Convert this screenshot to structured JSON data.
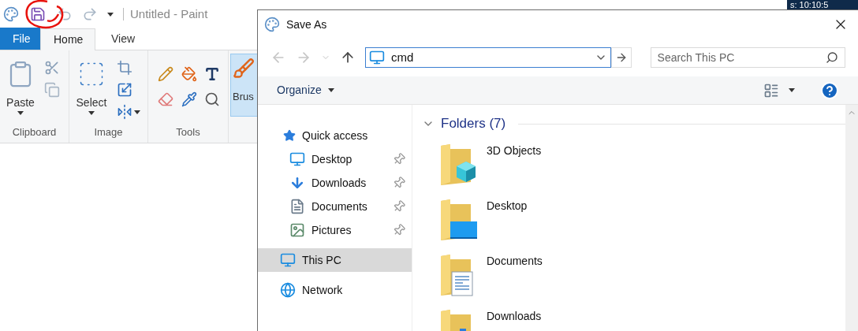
{
  "paint": {
    "title": "Untitled - Paint",
    "tabs": [
      {
        "label": "File",
        "kind": "file",
        "selected": false
      },
      {
        "label": "Home",
        "kind": "tab",
        "selected": true
      },
      {
        "label": "View",
        "kind": "tab",
        "selected": false
      }
    ],
    "groups": [
      {
        "label": "Clipboard",
        "button": "Paste"
      },
      {
        "label": "Image",
        "button": "Select"
      },
      {
        "label": "Tools"
      }
    ],
    "brush_button": {
      "label": "Brus",
      "selected": true
    }
  },
  "clock_strip": "s: 10:10:5",
  "dialog": {
    "title": "Save As",
    "address": {
      "value": "cmd"
    },
    "search": {
      "placeholder": "Search This PC"
    },
    "organize": "Organize",
    "nav": [
      {
        "label": "Quick access",
        "selected": false,
        "children": [
          {
            "label": "Desktop",
            "pinned": true
          },
          {
            "label": "Downloads",
            "pinned": true
          },
          {
            "label": "Documents",
            "pinned": true
          },
          {
            "label": "Pictures",
            "pinned": true
          }
        ]
      },
      {
        "label": "This PC",
        "selected": true
      },
      {
        "label": "Network",
        "selected": false
      }
    ],
    "section": {
      "title": "Folders (7)",
      "expanded": true
    },
    "folders": [
      {
        "name": "3D Objects"
      },
      {
        "name": "Desktop"
      },
      {
        "name": "Documents"
      },
      {
        "name": "Downloads"
      }
    ]
  }
}
